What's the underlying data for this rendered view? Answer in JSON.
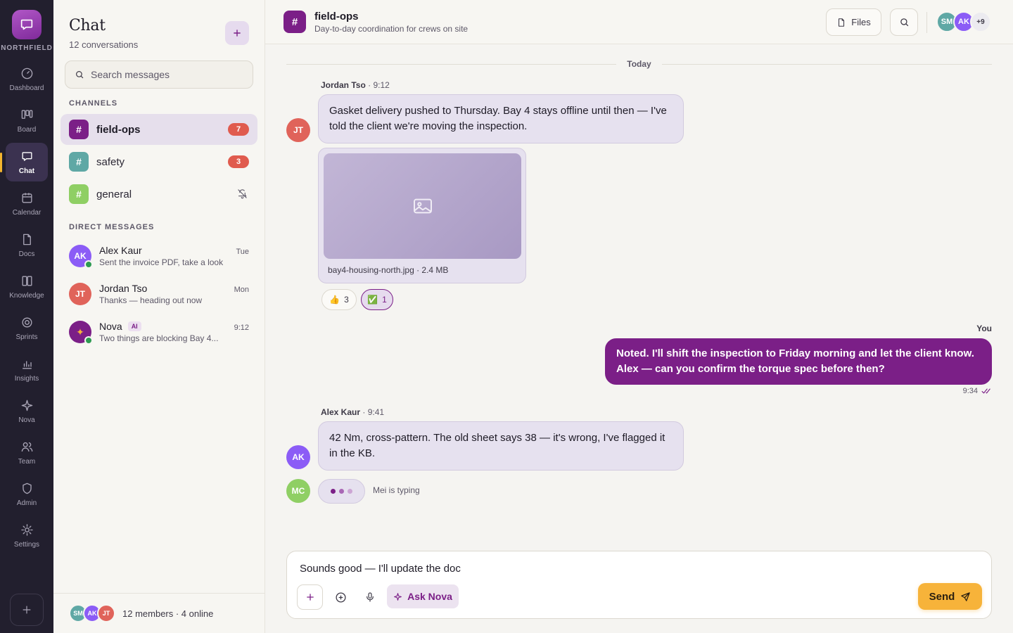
{
  "rail": {
    "brand": "NORTHFIELD",
    "items": [
      {
        "label": "Dashboard",
        "icon": "dashboard-icon"
      },
      {
        "label": "Board",
        "icon": "board-icon"
      },
      {
        "label": "Chat",
        "icon": "chat-icon",
        "active": true
      },
      {
        "label": "Calendar",
        "icon": "calendar-icon"
      },
      {
        "label": "Docs",
        "icon": "docs-icon"
      },
      {
        "label": "Knowledge",
        "icon": "knowledge-icon"
      },
      {
        "label": "Sprints",
        "icon": "sprints-icon"
      },
      {
        "label": "Insights",
        "icon": "insights-icon"
      },
      {
        "label": "Nova",
        "icon": "sparkle-icon"
      },
      {
        "label": "Team",
        "icon": "team-icon"
      },
      {
        "label": "Admin",
        "icon": "shield-icon"
      },
      {
        "label": "Settings",
        "icon": "gear-icon"
      }
    ],
    "add_label": "+"
  },
  "sidebar": {
    "title": "Chat",
    "subtitle": "12 conversations",
    "search_placeholder": "Search messages",
    "channels_heading": "CHANNELS",
    "channels": [
      {
        "name": "field-ops",
        "badge": "7",
        "color": "#7b1f87",
        "active": true
      },
      {
        "name": "safety",
        "badge": "3",
        "color": "#5fa8a5"
      },
      {
        "name": "general",
        "muted": true,
        "color": "#8fcf64"
      }
    ],
    "dm_heading": "DIRECT MESSAGES",
    "dms": [
      {
        "initials": "AK",
        "name": "Alex Kaur",
        "preview": "Sent the invoice PDF, take a look",
        "time": "Tue",
        "color": "#8b5cf6",
        "online": true
      },
      {
        "initials": "JT",
        "name": "Jordan Tso",
        "preview": "Thanks — heading out now",
        "time": "Mon",
        "color": "#e0635a"
      },
      {
        "initials": "✦",
        "name": "Nova",
        "tag": "AI",
        "preview": "Two things are blocking Bay 4...",
        "time": "9:12",
        "color": "#7b1f87",
        "online": true
      }
    ],
    "footer_avatars": [
      {
        "initials": "SM",
        "color": "#5fa8a5"
      },
      {
        "initials": "AK",
        "color": "#8b5cf6"
      },
      {
        "initials": "JT",
        "color": "#e0635a"
      }
    ],
    "footer_text": "12 members · 4 online"
  },
  "header": {
    "channel": "field-ops",
    "description": "Day-to-day coordination for crews on site",
    "files_label": "Files",
    "members": [
      {
        "initials": "SM",
        "color": "#5fa8a5"
      },
      {
        "initials": "AK",
        "color": "#8b5cf6"
      }
    ],
    "more_members": "+9"
  },
  "thread": {
    "day": "Today",
    "m1": {
      "author": "Jordan Tso",
      "time": "9:12",
      "initials": "JT",
      "color": "#e0635a",
      "text": "Gasket delivery pushed to Thursday. Bay 4 stays offline until then — I've told the client we're moving the inspection."
    },
    "attachment": {
      "caption": "bay4-housing-north.jpg · 2.4 MB"
    },
    "reactions": [
      {
        "emoji": "👍",
        "count": "3"
      },
      {
        "emoji": "✅",
        "count": "1",
        "selected": true
      }
    ],
    "m2": {
      "author": "You",
      "text": "Noted. I'll shift the inspection to Friday morning and let the client know. Alex — can you confirm the torque spec before then?",
      "time": "9:34",
      "status": "read"
    },
    "m3": {
      "author": "Alex Kaur",
      "time": "9:41",
      "initials": "AK",
      "color": "#8b5cf6",
      "text": "42 Nm, cross-pattern. The old sheet says 38 — it's wrong, I've flagged it in the KB."
    },
    "typing": {
      "initials": "MC",
      "color": "#8fcf64",
      "text": "Mei is typing"
    }
  },
  "composer": {
    "value": "Sounds good — I'll update the doc",
    "plus_label": "+",
    "ask_label": "Ask Nova",
    "send_label": "Send"
  },
  "colors": {
    "accent": "#7b1f87",
    "send": "#f7b33a",
    "badge": "#e05b4e",
    "rail": "#221f2e"
  }
}
